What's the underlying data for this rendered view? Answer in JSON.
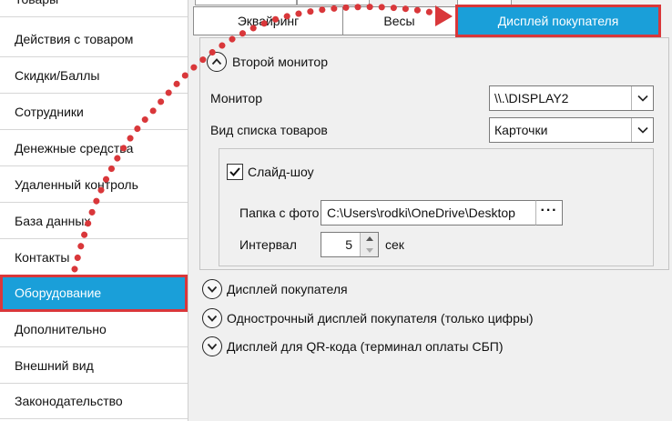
{
  "sidebar": {
    "items": [
      {
        "label": "Товары"
      },
      {
        "label": "Действия с товаром"
      },
      {
        "label": "Скидки/Баллы"
      },
      {
        "label": "Сотрудники"
      },
      {
        "label": "Денежные средства"
      },
      {
        "label": "Удаленный контроль"
      },
      {
        "label": "База данных"
      },
      {
        "label": "Контакты"
      },
      {
        "label": "Оборудование"
      },
      {
        "label": "Дополнительно"
      },
      {
        "label": "Внешний вид"
      },
      {
        "label": "Законодательство"
      }
    ],
    "active_index": 8
  },
  "tabs": [
    {
      "label": "Эквайринг"
    },
    {
      "label": "Весы"
    },
    {
      "label": "Дисплей покупателя",
      "active": true
    }
  ],
  "second_monitor": {
    "title": "Второй монитор",
    "monitor_label": "Монитор",
    "monitor_value": "\\\\.\\DISPLAY2",
    "list_view_label": "Вид списка товаров",
    "list_view_value": "Карточки",
    "slideshow": {
      "label": "Слайд-шоу",
      "checked": true,
      "folder_label": "Папка с фото",
      "folder_value": "C:\\Users\\rodki\\OneDrive\\Desktop",
      "browse_label": "···",
      "interval_label": "Интервал",
      "interval_value": "5",
      "interval_unit": "сек"
    }
  },
  "sections": [
    {
      "label": "Дисплей покупателя"
    },
    {
      "label": "Однострочный дисплей покупателя (только цифры)"
    },
    {
      "label": "Дисплей для QR-кода (терминал оплаты СБП)"
    }
  ],
  "colors": {
    "accent": "#1a9fd9",
    "highlight": "#d9373a"
  }
}
